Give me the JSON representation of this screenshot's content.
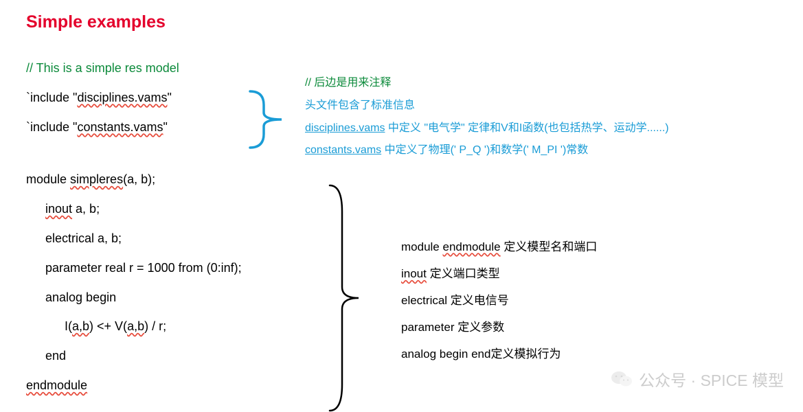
{
  "title": "Simple examples",
  "code": {
    "line1_comment": "// This is a simple res model",
    "line2a": "`include \"",
    "line2b": "disciplines.vams",
    "line2c": "\"",
    "line3a": "`include \"",
    "line3b": "constants.vams",
    "line3c": "\"",
    "line4a": "module ",
    "line4b": "simpleres",
    "line4c": "(a, b);",
    "line5a": "inout",
    "line5b": " a, b;",
    "line6": "electrical a, b;",
    "line7": "parameter real r = 1000 from (0:inf);",
    "line8": "analog begin",
    "line9a": "I(",
    "line9b": "a,b",
    "line9c": ") <+ V(",
    "line9d": "a,b",
    "line9e": ") / r;",
    "line10": "end",
    "line11": "endmodule"
  },
  "anno1": {
    "l1": "// 后边是用来注释",
    "l2": "头文件包含了标准信息",
    "l3a": "disciplines.vams",
    "l3b": " 中定义 \"电气学\" 定律和V和I函数(也包括热学、运动学......)",
    "l4a": "constants.vams",
    "l4b": " 中定义了物理(' P_Q ')和数学(' M_PI ')常数"
  },
  "anno2": {
    "l1a": "module  ",
    "l1b": "endmodule",
    "l1c": " 定义模型名和端口",
    "l2a": "inout",
    "l2b": " 定义端口类型",
    "l3": "electrical 定义电信号",
    "l4": "parameter 定义参数",
    "l5": "analog begin end定义模拟行为"
  },
  "watermark": "公众号 · SPICE 模型"
}
